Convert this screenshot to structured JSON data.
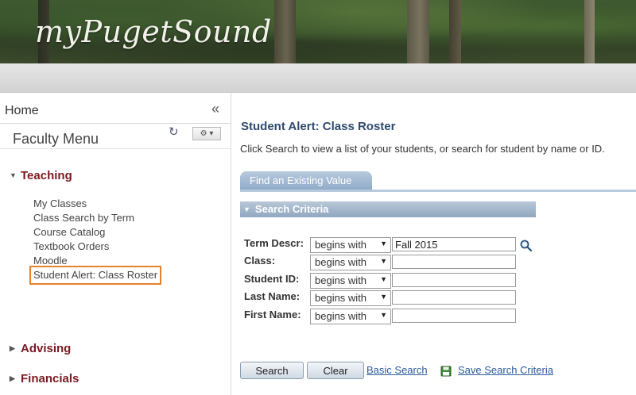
{
  "banner": {
    "brand": "myPugetSound"
  },
  "sidebar": {
    "home": "Home",
    "collapse_glyph": "«",
    "menu_title": "Faculty Menu",
    "refresh_glyph": "↻",
    "gear_glyph": "⚙ ▾",
    "sections": [
      {
        "label": "Teaching",
        "expanded": true
      },
      {
        "label": "Advising",
        "expanded": false
      },
      {
        "label": "Financials",
        "expanded": false
      }
    ],
    "teaching_links": [
      "My Classes",
      "Class Search by Term",
      "Course Catalog",
      "Textbook Orders",
      "Moodle",
      "Student Alert: Class Roster"
    ],
    "selected_link": "Student Alert: Class Roster"
  },
  "main": {
    "title": "Student Alert: Class Roster",
    "instructions": "Click Search to view a list of your students, or search for student by name or ID.",
    "tab": "Find an Existing Value",
    "criteria_header": "Search Criteria",
    "rows": [
      {
        "label": "Term Descr:",
        "operator": "begins with",
        "value": "Fall 2015"
      },
      {
        "label": "Class:",
        "operator": "begins with",
        "value": ""
      },
      {
        "label": "Student ID:",
        "operator": "begins with",
        "value": ""
      },
      {
        "label": "Last Name:",
        "operator": "begins with",
        "value": ""
      },
      {
        "label": "First Name:",
        "operator": "begins with",
        "value": ""
      }
    ],
    "buttons": {
      "search": "Search",
      "clear": "Clear"
    },
    "links": {
      "basic_search": "Basic Search",
      "save_criteria": "Save Search Criteria"
    }
  },
  "colors": {
    "section_red": "#7b1a22",
    "title_blue": "#2f4a6d",
    "link_blue": "#2a5a9a",
    "highlight_orange": "#e8802a"
  },
  "icons": [
    "collapse-icon",
    "refresh-icon",
    "gear-icon",
    "triangle-icon",
    "lookup-icon",
    "save-icon"
  ]
}
